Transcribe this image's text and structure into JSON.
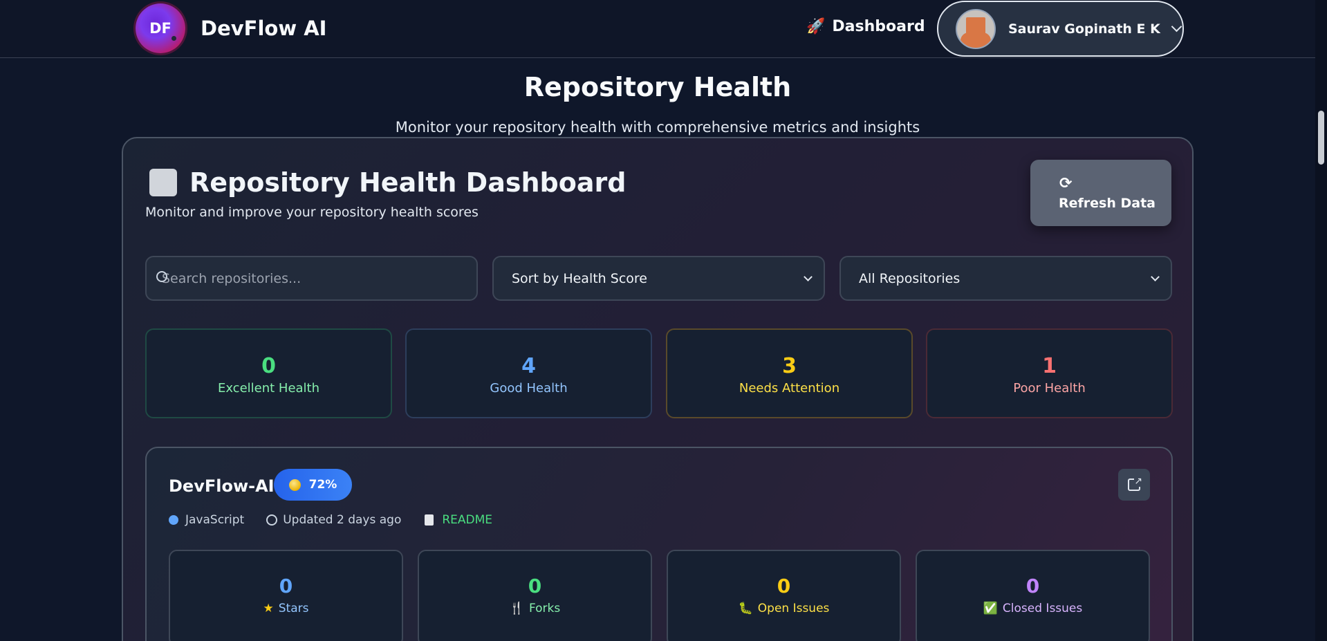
{
  "navbar": {
    "logo_text": "DF",
    "brand": "DevFlow AI",
    "dashboard_label": "Dashboard",
    "dashboard_icon": "🚀",
    "user_name": "Saurav Gopinath E K"
  },
  "page": {
    "title": "Repository Health",
    "subtitle": "Monitor your repository health with comprehensive metrics and insights"
  },
  "dashboard": {
    "title": "Repository Health Dashboard",
    "subtitle": "Monitor and improve your repository health scores",
    "refresh_label": "Refresh Data",
    "refresh_icon": "⟳"
  },
  "filters": {
    "search_placeholder": "Search repositories...",
    "sort_value": "Sort by Health Score",
    "scope_value": "All Repositories"
  },
  "summary": [
    {
      "value": "0",
      "label": "Excellent Health",
      "color": "#4ade80",
      "label_color": "#86efac",
      "border": "#1f4a44"
    },
    {
      "value": "4",
      "label": "Good Health",
      "color": "#60a5fa",
      "label_color": "#93c5fd",
      "border": "#2d3e5c"
    },
    {
      "value": "3",
      "label": "Needs Attention",
      "color": "#facc15",
      "label_color": "#fde047",
      "border": "#5a4a2a"
    },
    {
      "value": "1",
      "label": "Poor Health",
      "color": "#f87171",
      "label_color": "#fca5a5",
      "border": "#4b2a36"
    }
  ],
  "repo": {
    "name": "DevFlow-AI",
    "score": "72%",
    "language": "JavaScript",
    "updated": "Updated 2 days ago",
    "readme": "README",
    "stats": [
      {
        "value": "0",
        "label": "Stars",
        "icon": "★",
        "icon_name": "star-icon",
        "color": "#60a5fa",
        "label_color": "#93c5fd",
        "icon_color": "#facc15"
      },
      {
        "value": "0",
        "label": "Forks",
        "icon": "🍴",
        "icon_name": "fork-icon",
        "color": "#4ade80",
        "label_color": "#86efac",
        "icon_color": "#e5e7eb"
      },
      {
        "value": "0",
        "label": "Open Issues",
        "icon": "🐛",
        "icon_name": "bug-icon",
        "color": "#facc15",
        "label_color": "#fde047",
        "icon_color": "#34d399"
      },
      {
        "value": "0",
        "label": "Closed Issues",
        "icon": "✅",
        "icon_name": "check-icon",
        "color": "#c084fc",
        "label_color": "#d8b4fe",
        "icon_color": "#22c55e"
      }
    ]
  }
}
